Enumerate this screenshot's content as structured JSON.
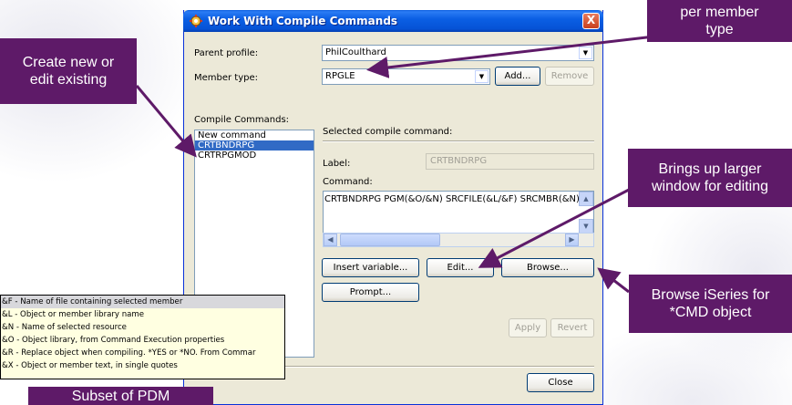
{
  "dialog": {
    "title": "Work With Compile Commands",
    "close_label": "X",
    "parent_profile": {
      "label": "Parent profile:",
      "value": "PhilCoulthard"
    },
    "member_type": {
      "label": "Member type:",
      "value": "RPGLE",
      "add_label": "Add...",
      "remove_label": "Remove"
    },
    "compile_commands": {
      "label": "Compile Commands:",
      "items": [
        "New command",
        "CRTBNDRPG",
        "CRTRPGMOD"
      ],
      "selected": "CRTBNDRPG"
    },
    "selected_section": {
      "heading": "Selected compile command:",
      "label_caption": "Label:",
      "label_value": "CRTBNDRPG",
      "command_caption": "Command:",
      "command_text": "CRTBNDRPG PGM(&O/&N) SRCFILE(&L/&F) SRCMBR(&N) R"
    },
    "buttons": {
      "insert_variable": "Insert variable...",
      "edit": "Edit...",
      "browse": "Browse...",
      "prompt": "Prompt...",
      "apply": "Apply",
      "revert": "Revert",
      "close": "Close"
    }
  },
  "callouts": {
    "top_right": "per member type",
    "create_new": "Create new or edit existing",
    "brings_up": "Brings up larger window for editing",
    "browse_iseries": "Browse iSeries for *CMD object",
    "subset": "Subset of PDM"
  },
  "tooltip": {
    "lines": [
      "&F - Name of file containing selected member",
      "&L - Object or member library name",
      "&N - Name of selected resource",
      "&O - Object library, from Command Execution properties",
      "&R - Replace object when compiling. *YES or *NO. From Commar",
      "&X - Object or member text, in single quotes"
    ]
  },
  "colors": {
    "callout": "#5e1a68",
    "titlebar": "#0653d6",
    "selection": "#316ac5"
  }
}
